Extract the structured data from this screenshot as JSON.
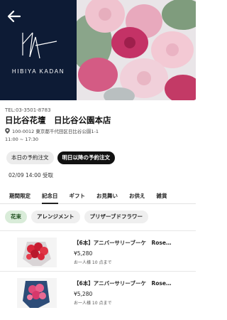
{
  "header": {
    "back_icon": "arrow-left-icon",
    "brand_logo_text": "HIBIYA KADAN",
    "hero_image": "bouquet-of-pink-roses"
  },
  "store": {
    "tel": "TEL:03-3501-8783",
    "name": "日比谷花壇　日比谷公園本店",
    "address_icon": "location-pin-icon",
    "address": "100-0012 東京都千代田区日比谷公園1-1",
    "hours": "11:00 ~ 17:30"
  },
  "order_modes": [
    {
      "label": "本日の予約注文",
      "active": false
    },
    {
      "label": "明日以降の予約注文",
      "active": true
    }
  ],
  "pickup": {
    "text": "02/09 14:00 受取"
  },
  "tabs": [
    {
      "label": "期間限定",
      "active": false
    },
    {
      "label": "記念日",
      "active": true
    },
    {
      "label": "ギフト",
      "active": false
    },
    {
      "label": "お見舞い",
      "active": false
    },
    {
      "label": "お供え",
      "active": false
    },
    {
      "label": "雑貨",
      "active": false
    }
  ],
  "subcategories": [
    {
      "label": "花束",
      "active": true
    },
    {
      "label": "アレンジメント",
      "active": false
    },
    {
      "label": "プリザーブドフラワー",
      "active": false
    }
  ],
  "products": [
    {
      "name": "【6本】アニバーサリーブーケ　Rose…",
      "price": "¥5,280",
      "limit": "お一人様 10 点まで",
      "image": "red-rose-bouquet",
      "color": "#d8263a"
    },
    {
      "name": "【6本】アニバーサリーブーケ　Rose…",
      "price": "¥5,280",
      "limit": "お一人様 10 点まで",
      "image": "pink-rose-bouquet",
      "color": "#e04a7a"
    }
  ],
  "colors": {
    "brand_navy": "#0d1b35",
    "chip_active_bg": "#d9ecd9",
    "active_mode_bg": "#111111"
  }
}
